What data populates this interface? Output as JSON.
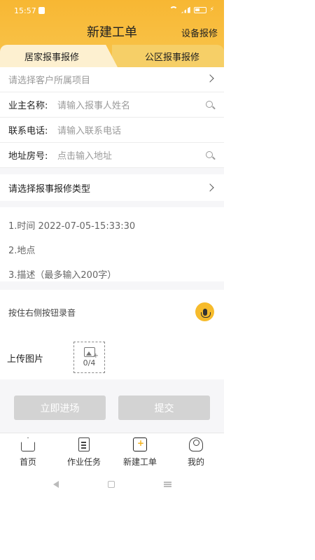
{
  "status": {
    "time": "15:57"
  },
  "header": {
    "title": "新建工单",
    "right_link": "设备报修"
  },
  "tabs": [
    {
      "label": "居家报事报修",
      "active": true
    },
    {
      "label": "公区报事报修",
      "active": false
    }
  ],
  "form": {
    "project_placeholder": "请选择客户所属项目",
    "owner": {
      "label": "业主名称:",
      "placeholder": "请输入报事人姓名"
    },
    "phone": {
      "label": "联系电话:",
      "placeholder": "请输入联系电话"
    },
    "address": {
      "label": "地址房号:",
      "placeholder": "点击输入地址"
    },
    "repair_type_placeholder": "请选择报事报修类型"
  },
  "description": {
    "time_line": "1.时间 2022-07-05-15:33:30",
    "place_line": "2.地点",
    "desc_line": "3.描述（最多输入200字）"
  },
  "record": {
    "hint": "按住右侧按钮录音"
  },
  "upload": {
    "label": "上传图片",
    "count": "0/4"
  },
  "actions": {
    "enter": "立即进场",
    "submit": "提交"
  },
  "nav": [
    {
      "label": "首页",
      "icon": "home-icon"
    },
    {
      "label": "作业任务",
      "icon": "task-icon"
    },
    {
      "label": "新建工单",
      "icon": "new-order-icon"
    },
    {
      "label": "我的",
      "icon": "user-icon"
    }
  ],
  "colors": {
    "accent": "#f7b733",
    "tab_active": "#fdf0d0",
    "tab_inactive": "#f6cf67",
    "button_disabled": "#d3d3d3"
  }
}
